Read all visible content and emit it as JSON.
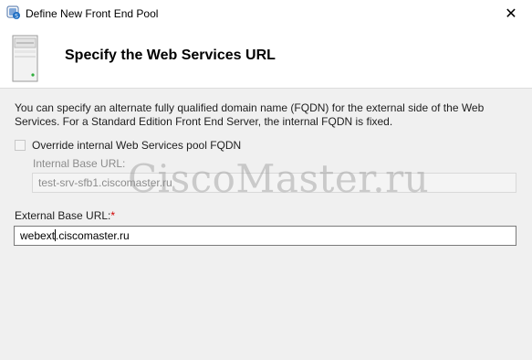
{
  "window": {
    "title": "Define New Front End Pool",
    "close_glyph": "✕"
  },
  "header": {
    "heading": "Specify the Web Services URL",
    "icon": "server-icon"
  },
  "content": {
    "description": "You can specify an alternate fully qualified domain name (FQDN) for the external side of the Web Services. For a Standard Edition Front End Server, the internal FQDN is fixed.",
    "override_checkbox": {
      "label": "Override internal Web Services pool FQDN",
      "checked": false,
      "enabled": true
    },
    "internal_url": {
      "label": "Internal Base URL:",
      "value": "test-srv-sfb1.ciscomaster.ru",
      "disabled": true
    },
    "external_url": {
      "label": "External Base URL:",
      "required_marker": "*",
      "value_before_caret": "webext",
      "value_after_caret": ".ciscomaster.ru"
    }
  },
  "watermark": "CiscoMaster.ru",
  "colors": {
    "required": "#d00000",
    "disabled_text": "#8c8c8c",
    "header_bg": "#ffffff",
    "body_bg": "#f0f0f0"
  }
}
